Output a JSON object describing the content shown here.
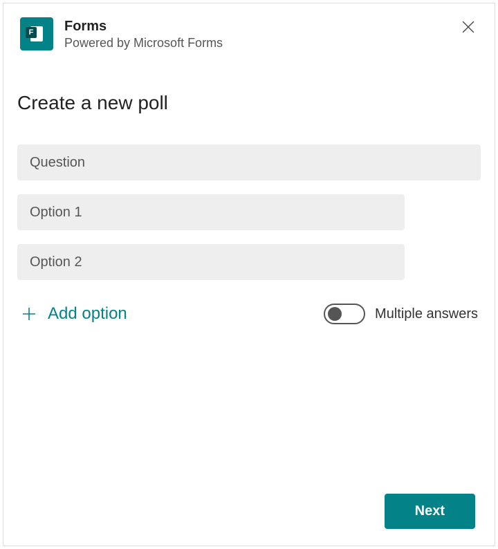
{
  "header": {
    "title": "Forms",
    "subtitle": "Powered by Microsoft Forms",
    "icon_letter": "F"
  },
  "page": {
    "title": "Create a new poll"
  },
  "question": {
    "placeholder": "Question",
    "value": ""
  },
  "options": [
    {
      "placeholder": "Option 1",
      "value": ""
    },
    {
      "placeholder": "Option 2",
      "value": ""
    }
  ],
  "add_option_label": "Add option",
  "multiple_answers": {
    "label": "Multiple answers",
    "enabled": false
  },
  "footer": {
    "next_label": "Next"
  },
  "colors": {
    "accent": "#038387"
  }
}
